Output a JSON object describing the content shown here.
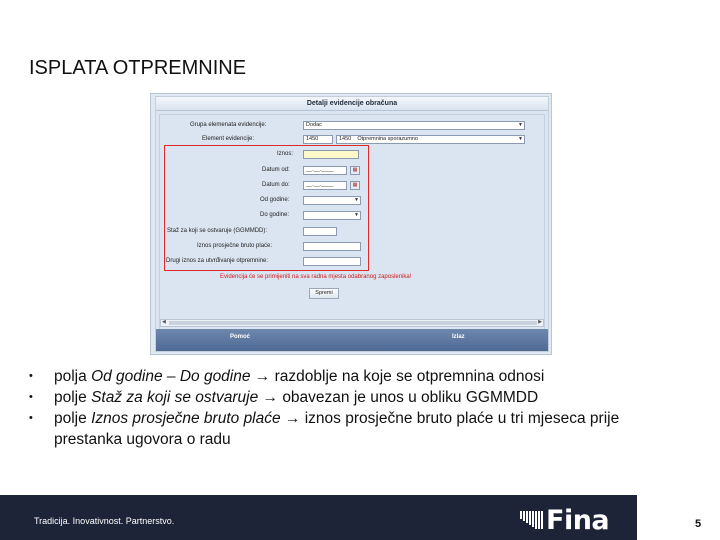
{
  "slide": {
    "title": "ISPLATA OTPREMNINE",
    "tagline": "Tradicija. Inovativnost. Partnerstvo.",
    "logo_text": "Fina",
    "page_number": "5"
  },
  "screenshot": {
    "panel_title": "Detalji evidencije obračuna",
    "form": {
      "grupa_label": "Grupa elemenata evidencije:",
      "grupa_value": "Dodac",
      "element_label": "Element evidencije:",
      "element_code": "1450",
      "element_code2": "1450",
      "element_name": "Otpremnina sporazumno",
      "iznos_label": "Iznos:",
      "datum_od_label": "Datum od:",
      "datum_od_value": "__.__.____",
      "datum_do_label": "Datum do:",
      "datum_do_value": "__.__.____",
      "od_godine_label": "Od godine:",
      "do_godine_label": "Do godine:",
      "staz_label": "Staž za koji se ostvaruje (GGMMDD):",
      "iznos_prosjecne_label": "Iznos prosječne bruto plaće:",
      "drugi_label": "Drugi iznos za utvrđivanje otpremnine:",
      "warning": "Evidencija će se primijeniti na sva radna mjesta odabranog zaposlenika!",
      "save_button": "Spremi"
    },
    "footer": {
      "help": "Pomoć",
      "exit": "Izlaz"
    }
  },
  "bullets": [
    {
      "pre": "polja ",
      "em": "Od godine – Do godine",
      "post": " → razdoblje na koje se otpremnina odnosi"
    },
    {
      "pre": "polje ",
      "em": "Staž za koji se ostvaruje",
      "post": " → obavezan je unos u obliku GGMMDD"
    },
    {
      "pre": "polje ",
      "em": "Iznos prosječne bruto plaće",
      "post": " → iznos prosječne bruto plaće u tri mjeseca prije prestanka ugovora o radu"
    }
  ],
  "colors": {
    "footer_band": "#1e2438",
    "highlight_box": "#e02a2a",
    "warning_text": "#d21a1a"
  }
}
